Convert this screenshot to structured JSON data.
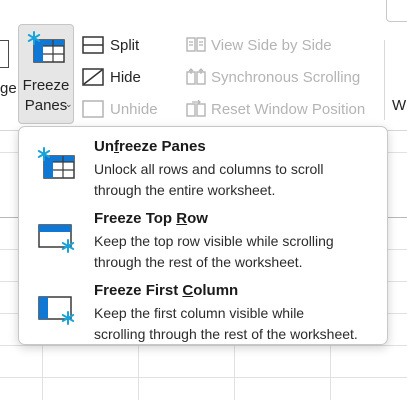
{
  "ribbon": {
    "left_cut_text": "ge",
    "freeze_panes": {
      "line1": "Freeze",
      "line2": "Panes",
      "chevron": "⌄"
    },
    "split_label": "Split",
    "hide_label": "Hide",
    "unhide_label": "Unhide",
    "view_side_by_side_label": "View Side by Side",
    "synchronous_scrolling_label": "Synchronous Scrolling",
    "reset_window_position_label": "Reset Window Position",
    "right_cut_text": "W"
  },
  "menu": {
    "items": [
      {
        "title_pre": "Un",
        "title_u": "f",
        "title_post": "reeze Panes",
        "desc1": "Unlock all rows and columns to scroll",
        "desc2": "through the entire worksheet.",
        "icon": "unfreeze-panes-icon"
      },
      {
        "title_pre": "Freeze Top ",
        "title_u": "R",
        "title_post": "ow",
        "desc1": "Keep the top row visible while scrolling",
        "desc2": "through the rest of the worksheet.",
        "icon": "freeze-top-row-icon"
      },
      {
        "title_pre": "Freeze First ",
        "title_u": "C",
        "title_post": "olumn",
        "desc1": "Keep the first column visible while",
        "desc2": "scrolling through the rest of the worksheet.",
        "icon": "freeze-first-column-icon"
      }
    ]
  },
  "colors": {
    "accent": "#0f78d4",
    "snowflake": "#1aa3d9",
    "disabled": "#b4b4b4"
  }
}
